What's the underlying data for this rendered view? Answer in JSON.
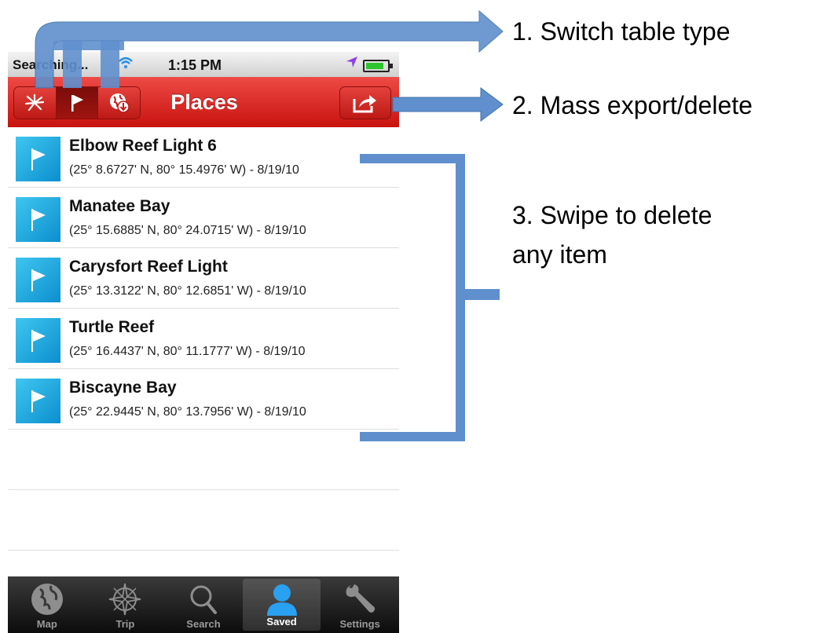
{
  "status_bar": {
    "carrier": "Searching...",
    "time": "1:15 PM",
    "battery_level": 0.85
  },
  "nav": {
    "title": "Places",
    "segments": [
      {
        "name": "waypoints",
        "icon": "compass-rose-icon",
        "active": false
      },
      {
        "name": "places",
        "icon": "flag-icon",
        "active": true
      },
      {
        "name": "downloads",
        "icon": "globe-download-icon",
        "active": false
      }
    ],
    "export_icon": "share-export-icon"
  },
  "places": [
    {
      "name": "Elbow Reef Light 6",
      "coords": "(25° 8.6727' N, 80° 15.4976' W) - 8/19/10"
    },
    {
      "name": "Manatee Bay",
      "coords": "(25° 15.6885' N, 80° 24.0715' W) - 8/19/10"
    },
    {
      "name": "Carysfort Reef Light",
      "coords": "(25° 13.3122' N, 80° 12.6851' W) - 8/19/10"
    },
    {
      "name": "Turtle Reef",
      "coords": "(25° 16.4437' N, 80° 11.1777' W) - 8/19/10"
    },
    {
      "name": "Biscayne Bay",
      "coords": "(25° 22.9445' N, 80° 13.7956' W) - 8/19/10"
    }
  ],
  "tabs": [
    {
      "label": "Map",
      "icon": "globe-icon",
      "active": false
    },
    {
      "label": "Trip",
      "icon": "compass-icon",
      "active": false
    },
    {
      "label": "Search",
      "icon": "search-icon",
      "active": false
    },
    {
      "label": "Saved",
      "icon": "person-icon",
      "active": true
    },
    {
      "label": "Settings",
      "icon": "wrench-icon",
      "active": false
    }
  ],
  "annotations": {
    "switch_table": "1. Switch table type",
    "mass_export": "2. Mass export/delete",
    "swipe_line1": "3. Swipe to delete",
    "swipe_line2": "any item"
  },
  "colors": {
    "nav_red": "#d9241f",
    "accent_blue": "#5f90cd",
    "thumb_blue": "#1aa6e0",
    "tab_active": "#2aa0f0"
  }
}
